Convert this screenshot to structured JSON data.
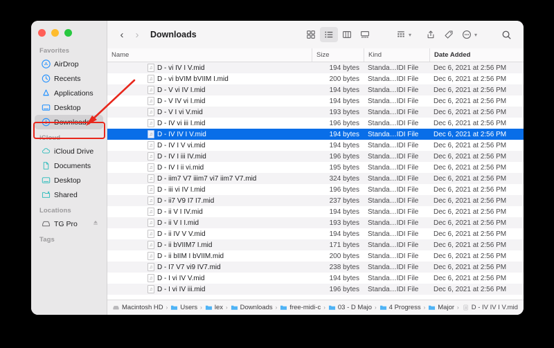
{
  "window": {
    "title": "Downloads",
    "traffic_lights": [
      "close",
      "minimize",
      "maximize"
    ]
  },
  "toolbar": {
    "back_label": "‹",
    "forward_label": "›",
    "view_icon_grid": "grid-view-icon",
    "view_icon_list": "list-view-icon",
    "view_icon_column": "column-view-icon",
    "view_icon_gallery": "gallery-view-icon",
    "group_icon": "group-by-icon",
    "share_icon": "share-icon",
    "tag_icon": "tag-icon",
    "more_icon": "more-actions-icon",
    "search_icon": "search-icon",
    "caret": "⌄"
  },
  "sidebar": {
    "sections": [
      {
        "title": "Favorites",
        "items": [
          {
            "label": "AirDrop",
            "icon": "airdrop-icon",
            "selected": false
          },
          {
            "label": "Recents",
            "icon": "recents-clock-icon",
            "selected": false
          },
          {
            "label": "Applications",
            "icon": "applications-icon",
            "selected": false
          },
          {
            "label": "Desktop",
            "icon": "desktop-icon",
            "selected": false
          },
          {
            "label": "Downloads",
            "icon": "downloads-icon",
            "selected": true
          }
        ]
      },
      {
        "title": "iCloud",
        "items": [
          {
            "label": "iCloud Drive",
            "icon": "icloud-cloud-icon",
            "selected": false
          },
          {
            "label": "Documents",
            "icon": "documents-file-icon",
            "selected": false
          },
          {
            "label": "Desktop",
            "icon": "desktop-icon",
            "selected": false
          },
          {
            "label": "Shared",
            "icon": "shared-folder-icon",
            "selected": false
          }
        ]
      },
      {
        "title": "Locations",
        "items": [
          {
            "label": "TG Pro",
            "icon": "external-drive-icon",
            "eject": "⏏",
            "selected": false
          }
        ]
      },
      {
        "title": "Tags",
        "items": []
      }
    ]
  },
  "columns": {
    "name": "Name",
    "size": "Size",
    "kind": "Kind",
    "date": "Date Added"
  },
  "files": [
    {
      "name": "D - vi IV I V.mid",
      "size": "194 bytes",
      "kind": "Standa…IDI File",
      "date": "Dec 6, 2021 at 2:56 PM",
      "selected": false
    },
    {
      "name": "D - vi bVIM bVIIM I.mid",
      "size": "200 bytes",
      "kind": "Standa…IDI File",
      "date": "Dec 6, 2021 at 2:56 PM",
      "selected": false
    },
    {
      "name": "D - V vi IV I.mid",
      "size": "194 bytes",
      "kind": "Standa…IDI File",
      "date": "Dec 6, 2021 at 2:56 PM",
      "selected": false
    },
    {
      "name": "D - V IV vi I.mid",
      "size": "194 bytes",
      "kind": "Standa…IDI File",
      "date": "Dec 6, 2021 at 2:56 PM",
      "selected": false
    },
    {
      "name": "D - V I vi V.mid",
      "size": "193 bytes",
      "kind": "Standa…IDI File",
      "date": "Dec 6, 2021 at 2:56 PM",
      "selected": false
    },
    {
      "name": "D - IV vi iii I.mid",
      "size": "196 bytes",
      "kind": "Standa…IDI File",
      "date": "Dec 6, 2021 at 2:56 PM",
      "selected": false
    },
    {
      "name": "D - IV IV I V.mid",
      "size": "194 bytes",
      "kind": "Standa…IDI File",
      "date": "Dec 6, 2021 at 2:56 PM",
      "selected": true
    },
    {
      "name": "D - IV I V vi.mid",
      "size": "194 bytes",
      "kind": "Standa…IDI File",
      "date": "Dec 6, 2021 at 2:56 PM",
      "selected": false
    },
    {
      "name": "D - IV I iii IV.mid",
      "size": "196 bytes",
      "kind": "Standa…IDI File",
      "date": "Dec 6, 2021 at 2:56 PM",
      "selected": false
    },
    {
      "name": "D - IV I ii vi.mid",
      "size": "195 bytes",
      "kind": "Standa…IDI File",
      "date": "Dec 6, 2021 at 2:56 PM",
      "selected": false
    },
    {
      "name": "D - iim7 V7 iiim7 vi7 iim7 V7.mid",
      "size": "324 bytes",
      "kind": "Standa…IDI File",
      "date": "Dec 6, 2021 at 2:56 PM",
      "selected": false
    },
    {
      "name": "D - iii vi IV I.mid",
      "size": "196 bytes",
      "kind": "Standa…IDI File",
      "date": "Dec 6, 2021 at 2:56 PM",
      "selected": false
    },
    {
      "name": "D - ii7 V9 I7 I7.mid",
      "size": "237 bytes",
      "kind": "Standa…IDI File",
      "date": "Dec 6, 2021 at 2:56 PM",
      "selected": false
    },
    {
      "name": "D - ii V I IV.mid",
      "size": "194 bytes",
      "kind": "Standa…IDI File",
      "date": "Dec 6, 2021 at 2:56 PM",
      "selected": false
    },
    {
      "name": "D - ii V I I.mid",
      "size": "193 bytes",
      "kind": "Standa…IDI File",
      "date": "Dec 6, 2021 at 2:56 PM",
      "selected": false
    },
    {
      "name": "D - ii IV V V.mid",
      "size": "194 bytes",
      "kind": "Standa…IDI File",
      "date": "Dec 6, 2021 at 2:56 PM",
      "selected": false
    },
    {
      "name": "D - ii bVIIM7 I.mid",
      "size": "171 bytes",
      "kind": "Standa…IDI File",
      "date": "Dec 6, 2021 at 2:56 PM",
      "selected": false
    },
    {
      "name": "D - ii bIIM I bVIIM.mid",
      "size": "200 bytes",
      "kind": "Standa…IDI File",
      "date": "Dec 6, 2021 at 2:56 PM",
      "selected": false
    },
    {
      "name": "D - I7 V7 vi9 IV7.mid",
      "size": "238 bytes",
      "kind": "Standa…IDI File",
      "date": "Dec 6, 2021 at 2:56 PM",
      "selected": false
    },
    {
      "name": "D - I vi IV V.mid",
      "size": "194 bytes",
      "kind": "Standa…IDI File",
      "date": "Dec 6, 2021 at 2:56 PM",
      "selected": false
    },
    {
      "name": "D - I vi IV iii.mid",
      "size": "196 bytes",
      "kind": "Standa…IDI File",
      "date": "Dec 6, 2021 at 2:56 PM",
      "selected": false
    }
  ],
  "pathbar": {
    "separator": "›",
    "crumbs": [
      {
        "label": "Macintosh HD",
        "icon": "hard-drive-icon"
      },
      {
        "label": "Users",
        "icon": "folder-icon"
      },
      {
        "label": "lex",
        "icon": "folder-icon"
      },
      {
        "label": "Downloads",
        "icon": "folder-icon"
      },
      {
        "label": "free-midi-c",
        "icon": "folder-icon"
      },
      {
        "label": "03 - D Majo",
        "icon": "folder-icon"
      },
      {
        "label": "4 Progress",
        "icon": "folder-icon"
      },
      {
        "label": "Major",
        "icon": "folder-icon"
      },
      {
        "label": "D - IV IV I V.mid",
        "icon": "midi-file-icon"
      }
    ]
  },
  "annotation": {
    "arrow_color": "#e8271c",
    "highlight_color": "#e8271c",
    "points_to": "Downloads"
  }
}
